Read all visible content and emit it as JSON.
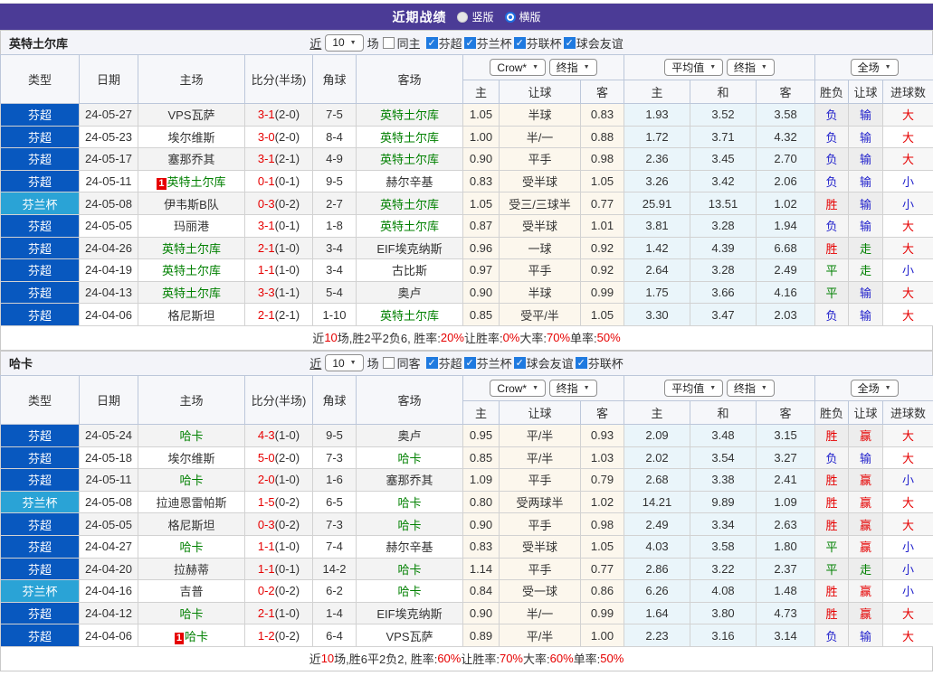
{
  "colors": {
    "banner_purple": "#4b3b96",
    "league_super_blue": "#0858bf",
    "league_cup_cyan": "#2aa3d6",
    "self_team_green": "#008000",
    "score_red": "#e60000",
    "win_big_red": "#e60000",
    "draw_push_green": "#008000",
    "lose_small_blue": "#2222cc"
  },
  "header": {
    "title": "近期战绩",
    "radios": [
      {
        "label": "竖版",
        "checked": false
      },
      {
        "label": "横版",
        "checked": true
      }
    ]
  },
  "filter": {
    "near": "近",
    "count": "10",
    "games": "场"
  },
  "table": {
    "dropdowns": {
      "bookmaker": "Crow*",
      "final_a": "终指",
      "average": "平均值",
      "final_b": "终指",
      "scope": "全场"
    },
    "columns": {
      "type": "类型",
      "date": "日期",
      "home": "主场",
      "score": "比分(半场)",
      "corner": "角球",
      "away": "客场",
      "odds_home": "主",
      "odds_handicap": "让球",
      "odds_away": "客",
      "avg_home": "主",
      "avg_draw": "和",
      "avg_away": "客",
      "res_wdl": "胜负",
      "res_handicap": "让球",
      "res_goals": "进球数"
    }
  },
  "teams": [
    {
      "name": "英特土尔库",
      "same_side_label": "同主",
      "same_side_checked": false,
      "leagues": [
        {
          "label": "芬超",
          "checked": true
        },
        {
          "label": "芬兰杯",
          "checked": true
        },
        {
          "label": "芬联杯",
          "checked": true
        },
        {
          "label": "球会友谊",
          "checked": true
        }
      ],
      "rows": [
        {
          "league": "芬超",
          "date": "24-05-27",
          "home": "VPS瓦萨",
          "home_self": false,
          "home_badge": "",
          "score": "3-1",
          "half": "(2-0)",
          "corner": "7-5",
          "away": "英特土尔库",
          "away_self": true,
          "away_badge": "",
          "odds": [
            "1.05",
            "半球",
            "0.83"
          ],
          "avg": [
            "1.93",
            "3.52",
            "3.58"
          ],
          "results": [
            "负",
            "输",
            "大"
          ]
        },
        {
          "league": "芬超",
          "date": "24-05-23",
          "home": "埃尔维斯",
          "home_self": false,
          "home_badge": "",
          "score": "3-0",
          "half": "(2-0)",
          "corner": "8-4",
          "away": "英特土尔库",
          "away_self": true,
          "away_badge": "",
          "odds": [
            "1.00",
            "半/一",
            "0.88"
          ],
          "avg": [
            "1.72",
            "3.71",
            "4.32"
          ],
          "results": [
            "负",
            "输",
            "大"
          ]
        },
        {
          "league": "芬超",
          "date": "24-05-17",
          "home": "塞那乔其",
          "home_self": false,
          "home_badge": "",
          "score": "3-1",
          "half": "(2-1)",
          "corner": "4-9",
          "away": "英特土尔库",
          "away_self": true,
          "away_badge": "",
          "odds": [
            "0.90",
            "平手",
            "0.98"
          ],
          "avg": [
            "2.36",
            "3.45",
            "2.70"
          ],
          "results": [
            "负",
            "输",
            "大"
          ]
        },
        {
          "league": "芬超",
          "date": "24-05-11",
          "home": "英特土尔库",
          "home_self": true,
          "home_badge": "1",
          "score": "0-1",
          "half": "(0-1)",
          "corner": "9-5",
          "away": "赫尔辛基",
          "away_self": false,
          "away_badge": "",
          "odds": [
            "0.83",
            "受半球",
            "1.05"
          ],
          "avg": [
            "3.26",
            "3.42",
            "2.06"
          ],
          "results": [
            "负",
            "输",
            "小"
          ]
        },
        {
          "league": "芬兰杯",
          "date": "24-05-08",
          "home": "伊韦斯B队",
          "home_self": false,
          "home_badge": "",
          "score": "0-3",
          "half": "(0-2)",
          "corner": "2-7",
          "away": "英特土尔库",
          "away_self": true,
          "away_badge": "",
          "odds": [
            "1.05",
            "受三/三球半",
            "0.77"
          ],
          "avg": [
            "25.91",
            "13.51",
            "1.02"
          ],
          "results": [
            "胜",
            "输",
            "小"
          ]
        },
        {
          "league": "芬超",
          "date": "24-05-05",
          "home": "玛丽港",
          "home_self": false,
          "home_badge": "",
          "score": "3-1",
          "half": "(0-1)",
          "corner": "1-8",
          "away": "英特土尔库",
          "away_self": true,
          "away_badge": "",
          "odds": [
            "0.87",
            "受半球",
            "1.01"
          ],
          "avg": [
            "3.81",
            "3.28",
            "1.94"
          ],
          "results": [
            "负",
            "输",
            "大"
          ]
        },
        {
          "league": "芬超",
          "date": "24-04-26",
          "home": "英特土尔库",
          "home_self": true,
          "home_badge": "",
          "score": "2-1",
          "half": "(1-0)",
          "corner": "3-4",
          "away": "EIF埃克纳斯",
          "away_self": false,
          "away_badge": "",
          "odds": [
            "0.96",
            "一球",
            "0.92"
          ],
          "avg": [
            "1.42",
            "4.39",
            "6.68"
          ],
          "results": [
            "胜",
            "走",
            "大"
          ]
        },
        {
          "league": "芬超",
          "date": "24-04-19",
          "home": "英特土尔库",
          "home_self": true,
          "home_badge": "",
          "score": "1-1",
          "half": "(1-0)",
          "corner": "3-4",
          "away": "古比斯",
          "away_self": false,
          "away_badge": "",
          "odds": [
            "0.97",
            "平手",
            "0.92"
          ],
          "avg": [
            "2.64",
            "3.28",
            "2.49"
          ],
          "results": [
            "平",
            "走",
            "小"
          ]
        },
        {
          "league": "芬超",
          "date": "24-04-13",
          "home": "英特土尔库",
          "home_self": true,
          "home_badge": "",
          "score": "3-3",
          "half": "(1-1)",
          "corner": "5-4",
          "away": "奥卢",
          "away_self": false,
          "away_badge": "",
          "odds": [
            "0.90",
            "半球",
            "0.99"
          ],
          "avg": [
            "1.75",
            "3.66",
            "4.16"
          ],
          "results": [
            "平",
            "输",
            "大"
          ]
        },
        {
          "league": "芬超",
          "date": "24-04-06",
          "home": "格尼斯坦",
          "home_self": false,
          "home_badge": "",
          "score": "2-1",
          "half": "(2-1)",
          "corner": "1-10",
          "away": "英特土尔库",
          "away_self": true,
          "away_badge": "",
          "odds": [
            "0.85",
            "受平/半",
            "1.05"
          ],
          "avg": [
            "3.30",
            "3.47",
            "2.03"
          ],
          "results": [
            "负",
            "输",
            "大"
          ]
        }
      ],
      "summary": [
        [
          "近",
          0
        ],
        [
          "10",
          1
        ],
        [
          "场,胜2平2负6, 胜率:",
          0
        ],
        [
          "20%",
          1
        ],
        [
          " 让胜率:",
          0
        ],
        [
          "0%",
          1
        ],
        [
          " 大率:",
          0
        ],
        [
          "70%",
          1
        ],
        [
          " 单率:",
          0
        ],
        [
          "50%",
          1
        ]
      ]
    },
    {
      "name": "哈卡",
      "same_side_label": "同客",
      "same_side_checked": false,
      "leagues": [
        {
          "label": "芬超",
          "checked": true
        },
        {
          "label": "芬兰杯",
          "checked": true
        },
        {
          "label": "球会友谊",
          "checked": true
        },
        {
          "label": "芬联杯",
          "checked": true
        }
      ],
      "rows": [
        {
          "league": "芬超",
          "date": "24-05-24",
          "home": "哈卡",
          "home_self": true,
          "home_badge": "",
          "score": "4-3",
          "half": "(1-0)",
          "corner": "9-5",
          "away": "奥卢",
          "away_self": false,
          "away_badge": "",
          "odds": [
            "0.95",
            "平/半",
            "0.93"
          ],
          "avg": [
            "2.09",
            "3.48",
            "3.15"
          ],
          "results": [
            "胜",
            "赢",
            "大"
          ]
        },
        {
          "league": "芬超",
          "date": "24-05-18",
          "home": "埃尔维斯",
          "home_self": false,
          "home_badge": "",
          "score": "5-0",
          "half": "(2-0)",
          "corner": "7-3",
          "away": "哈卡",
          "away_self": true,
          "away_badge": "",
          "odds": [
            "0.85",
            "平/半",
            "1.03"
          ],
          "avg": [
            "2.02",
            "3.54",
            "3.27"
          ],
          "results": [
            "负",
            "输",
            "大"
          ]
        },
        {
          "league": "芬超",
          "date": "24-05-11",
          "home": "哈卡",
          "home_self": true,
          "home_badge": "",
          "score": "2-0",
          "half": "(1-0)",
          "corner": "1-6",
          "away": "塞那乔其",
          "away_self": false,
          "away_badge": "",
          "odds": [
            "1.09",
            "平手",
            "0.79"
          ],
          "avg": [
            "2.68",
            "3.38",
            "2.41"
          ],
          "results": [
            "胜",
            "赢",
            "小"
          ]
        },
        {
          "league": "芬兰杯",
          "date": "24-05-08",
          "home": "拉迪恩雷帕斯",
          "home_self": false,
          "home_badge": "",
          "score": "1-5",
          "half": "(0-2)",
          "corner": "6-5",
          "away": "哈卡",
          "away_self": true,
          "away_badge": "",
          "odds": [
            "0.80",
            "受两球半",
            "1.02"
          ],
          "avg": [
            "14.21",
            "9.89",
            "1.09"
          ],
          "results": [
            "胜",
            "赢",
            "大"
          ]
        },
        {
          "league": "芬超",
          "date": "24-05-05",
          "home": "格尼斯坦",
          "home_self": false,
          "home_badge": "",
          "score": "0-3",
          "half": "(0-2)",
          "corner": "7-3",
          "away": "哈卡",
          "away_self": true,
          "away_badge": "",
          "odds": [
            "0.90",
            "平手",
            "0.98"
          ],
          "avg": [
            "2.49",
            "3.34",
            "2.63"
          ],
          "results": [
            "胜",
            "赢",
            "大"
          ]
        },
        {
          "league": "芬超",
          "date": "24-04-27",
          "home": "哈卡",
          "home_self": true,
          "home_badge": "",
          "score": "1-1",
          "half": "(1-0)",
          "corner": "7-4",
          "away": "赫尔辛基",
          "away_self": false,
          "away_badge": "",
          "odds": [
            "0.83",
            "受半球",
            "1.05"
          ],
          "avg": [
            "4.03",
            "3.58",
            "1.80"
          ],
          "results": [
            "平",
            "赢",
            "小"
          ]
        },
        {
          "league": "芬超",
          "date": "24-04-20",
          "home": "拉赫蒂",
          "home_self": false,
          "home_badge": "",
          "score": "1-1",
          "half": "(0-1)",
          "corner": "14-2",
          "away": "哈卡",
          "away_self": true,
          "away_badge": "",
          "odds": [
            "1.14",
            "平手",
            "0.77"
          ],
          "avg": [
            "2.86",
            "3.22",
            "2.37"
          ],
          "results": [
            "平",
            "走",
            "小"
          ]
        },
        {
          "league": "芬兰杯",
          "date": "24-04-16",
          "home": "吉普",
          "home_self": false,
          "home_badge": "",
          "score": "0-2",
          "half": "(0-2)",
          "corner": "6-2",
          "away": "哈卡",
          "away_self": true,
          "away_badge": "",
          "odds": [
            "0.84",
            "受一球",
            "0.86"
          ],
          "avg": [
            "6.26",
            "4.08",
            "1.48"
          ],
          "results": [
            "胜",
            "赢",
            "小"
          ]
        },
        {
          "league": "芬超",
          "date": "24-04-12",
          "home": "哈卡",
          "home_self": true,
          "home_badge": "",
          "score": "2-1",
          "half": "(1-0)",
          "corner": "1-4",
          "away": "EIF埃克纳斯",
          "away_self": false,
          "away_badge": "",
          "odds": [
            "0.90",
            "半/一",
            "0.99"
          ],
          "avg": [
            "1.64",
            "3.80",
            "4.73"
          ],
          "results": [
            "胜",
            "赢",
            "大"
          ]
        },
        {
          "league": "芬超",
          "date": "24-04-06",
          "home": "哈卡",
          "home_self": true,
          "home_badge": "1",
          "score": "1-2",
          "half": "(0-2)",
          "corner": "6-4",
          "away": "VPS瓦萨",
          "away_self": false,
          "away_badge": "",
          "odds": [
            "0.89",
            "平/半",
            "1.00"
          ],
          "avg": [
            "2.23",
            "3.16",
            "3.14"
          ],
          "results": [
            "负",
            "输",
            "大"
          ]
        }
      ],
      "summary": [
        [
          "近",
          0
        ],
        [
          "10",
          1
        ],
        [
          "场,胜6平2负2, 胜率:",
          0
        ],
        [
          "60%",
          1
        ],
        [
          " 让胜率:",
          0
        ],
        [
          "70%",
          1
        ],
        [
          " 大率:",
          0
        ],
        [
          "60%",
          1
        ],
        [
          " 单率:",
          0
        ],
        [
          "50%",
          1
        ]
      ]
    }
  ]
}
